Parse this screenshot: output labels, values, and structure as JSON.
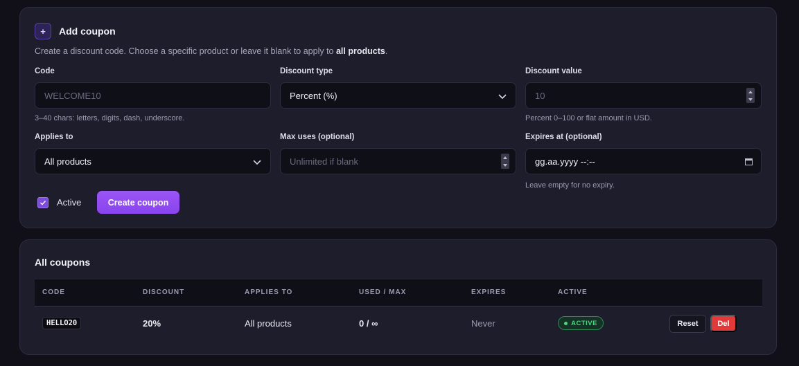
{
  "add_card": {
    "icon": "plus-icon",
    "plus_glyph": "+",
    "title": "Add coupon",
    "desc_prefix": "Create a discount code. Choose a specific product or leave it blank to apply to ",
    "desc_bold": "all products",
    "desc_suffix": ".",
    "code": {
      "label": "Code",
      "placeholder": "WELCOME10",
      "hint": "3–40 chars: letters, digits, dash, underscore."
    },
    "discount_type": {
      "label": "Discount type",
      "value": "Percent (%)"
    },
    "discount_value": {
      "label": "Discount value",
      "placeholder": "10",
      "hint": "Percent 0–100 or flat amount in USD."
    },
    "applies_to": {
      "label": "Applies to",
      "value": "All products"
    },
    "max_uses": {
      "label": "Max uses (optional)",
      "placeholder": "Unlimited if blank"
    },
    "expires_at": {
      "label": "Expires at (optional)",
      "value": "gg.aa.yyyy --:--",
      "hint": "Leave empty for no expiry."
    },
    "active": {
      "label": "Active",
      "checked": true
    },
    "create_button": "Create coupon"
  },
  "list_card": {
    "title": "All coupons",
    "columns": [
      "CODE",
      "DISCOUNT",
      "APPLIES TO",
      "USED / MAX",
      "EXPIRES",
      "ACTIVE"
    ],
    "rows": [
      {
        "code": "HELLO20",
        "discount": "20%",
        "applies_to": "All products",
        "used_max": "0 / ∞",
        "expires": "Never",
        "active": "ACTIVE",
        "reset_label": "Reset",
        "delete_label": "Del"
      }
    ]
  },
  "colors": {
    "accent": "#8a44ee",
    "active_green": "#4fd684",
    "danger": "#e23a3a"
  }
}
